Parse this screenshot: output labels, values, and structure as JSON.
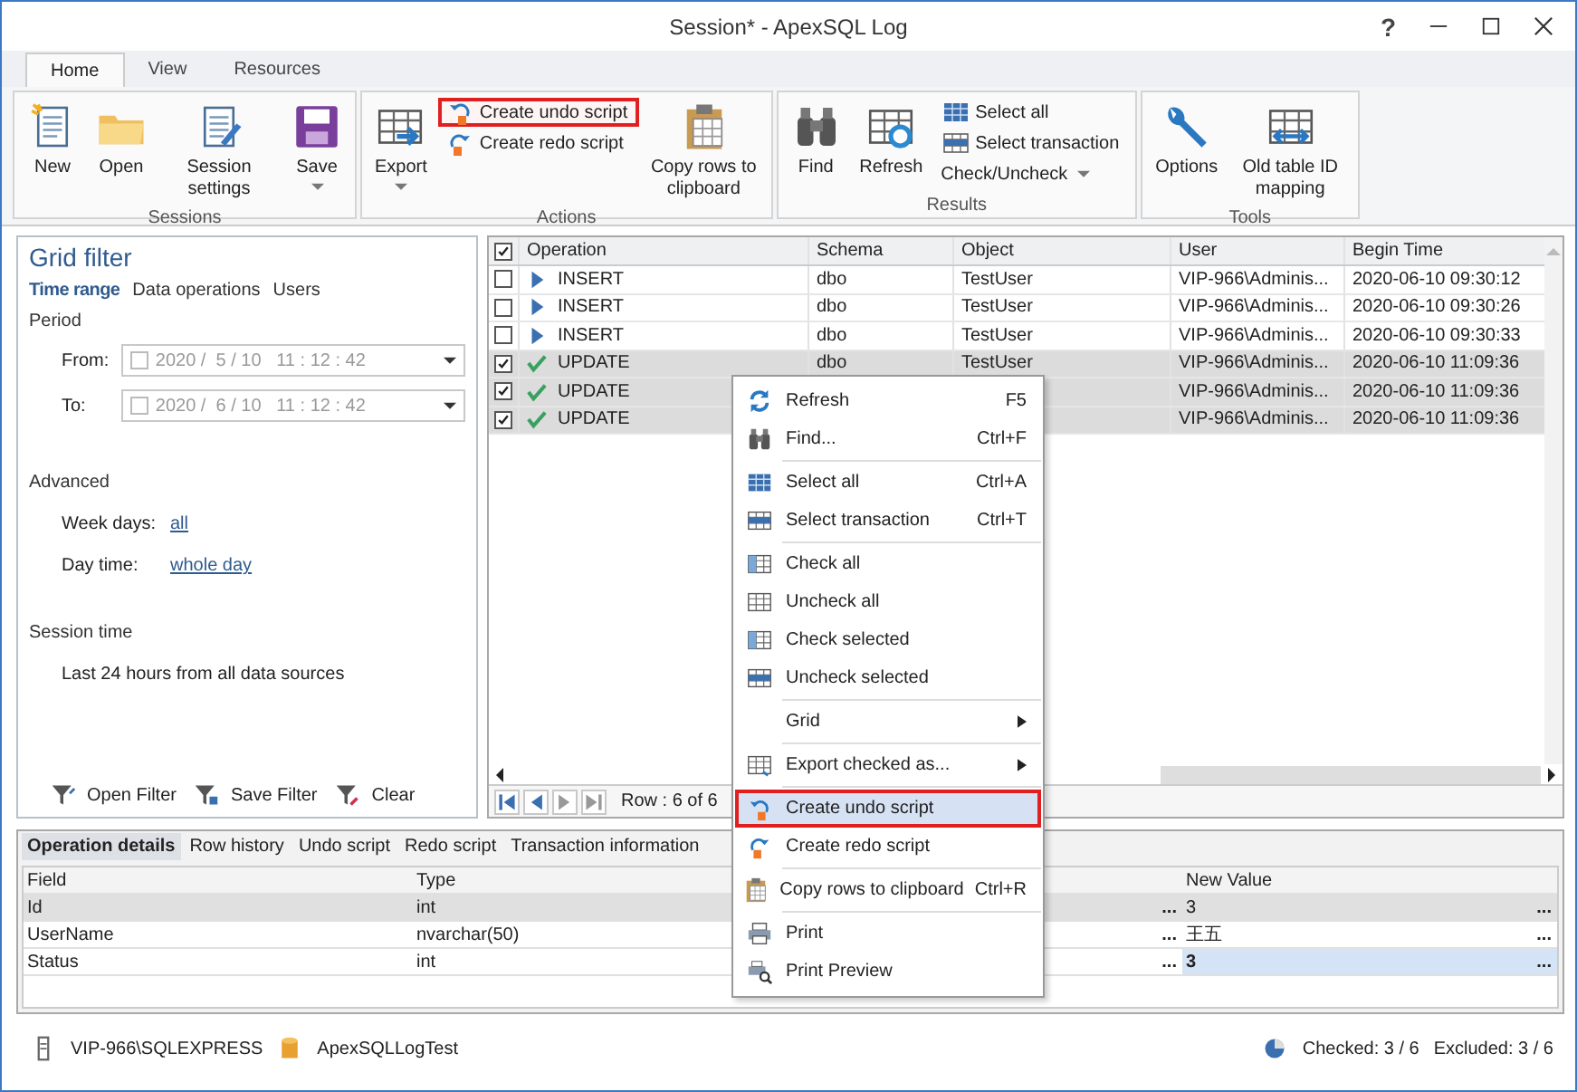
{
  "window": {
    "title": "Session* - ApexSQL Log",
    "help": "?"
  },
  "ribbon_tabs": [
    {
      "label": "Home",
      "selected": true
    },
    {
      "label": "View",
      "selected": false
    },
    {
      "label": "Resources",
      "selected": false
    }
  ],
  "ribbon_groups": [
    {
      "label": "Sessions",
      "items": [
        {
          "kind": "large",
          "label": "New",
          "dropdown": false,
          "highlighted": false
        },
        {
          "kind": "large",
          "label": "Open",
          "dropdown": false,
          "highlighted": false
        },
        {
          "kind": "large",
          "label": "Session settings",
          "dropdown": false,
          "highlighted": false
        },
        {
          "kind": "large",
          "label": "Save",
          "dropdown": true,
          "highlighted": false
        }
      ]
    },
    {
      "label": "Actions",
      "items": [
        {
          "kind": "large",
          "label": "Export",
          "dropdown": true,
          "highlighted": false
        },
        {
          "kind": "small",
          "label": "Create undo script",
          "dropdown": false,
          "highlighted": true
        },
        {
          "kind": "small",
          "label": "Create redo script",
          "dropdown": false,
          "highlighted": false
        },
        {
          "kind": "large",
          "label": "Copy rows to clipboard",
          "dropdown": false,
          "highlighted": false
        }
      ]
    },
    {
      "label": "Results",
      "items": [
        {
          "kind": "large",
          "label": "Find",
          "dropdown": false,
          "highlighted": false
        },
        {
          "kind": "large",
          "label": "Refresh",
          "dropdown": false,
          "highlighted": false
        },
        {
          "kind": "small",
          "label": "Select all",
          "dropdown": false,
          "highlighted": false
        },
        {
          "kind": "small",
          "label": "Select transaction",
          "dropdown": false,
          "highlighted": false
        },
        {
          "kind": "small",
          "label": "Check/Uncheck",
          "dropdown": true,
          "highlighted": false
        }
      ]
    },
    {
      "label": "Tools",
      "items": [
        {
          "kind": "large",
          "label": "Options",
          "dropdown": false,
          "highlighted": false
        },
        {
          "kind": "large",
          "label": "Old table ID mapping",
          "dropdown": false,
          "highlighted": false
        }
      ]
    }
  ],
  "grid_filter": {
    "title": "Grid filter",
    "tabs": [
      {
        "label": "Time range",
        "selected": true
      },
      {
        "label": "Data operations",
        "selected": false
      },
      {
        "label": "Users",
        "selected": false
      }
    ],
    "period": {
      "heading": "Period",
      "fields": [
        {
          "label": "From:",
          "value": "2020 /  5 / 10   11 : 12 : 42",
          "checked": false
        },
        {
          "label": "To:",
          "value": "2020 /  6 / 10   11 : 12 : 42",
          "checked": false
        }
      ]
    },
    "advanced": {
      "heading": "Advanced",
      "rows": [
        {
          "label": "Week days:",
          "link": "all"
        },
        {
          "label": "Day time:",
          "link": "whole day"
        }
      ]
    },
    "session_time": {
      "heading": "Session time",
      "text": "Last 24 hours from all data sources"
    },
    "buttons": [
      "Open Filter",
      "Save Filter",
      "Clear"
    ]
  },
  "grid": {
    "header_checked": true,
    "columns": [
      "Operation",
      "Schema",
      "Object",
      "User",
      "Begin Time"
    ],
    "rows": [
      {
        "checked": false,
        "selected": false,
        "kind": "insert",
        "operation": "INSERT",
        "schema": "dbo",
        "object": "TestUser",
        "user": "VIP-966\\Adminis...",
        "begin_time": "2020-06-10 09:30:12"
      },
      {
        "checked": false,
        "selected": false,
        "kind": "insert",
        "operation": "INSERT",
        "schema": "dbo",
        "object": "TestUser",
        "user": "VIP-966\\Adminis...",
        "begin_time": "2020-06-10 09:30:26"
      },
      {
        "checked": false,
        "selected": false,
        "kind": "insert",
        "operation": "INSERT",
        "schema": "dbo",
        "object": "TestUser",
        "user": "VIP-966\\Adminis...",
        "begin_time": "2020-06-10 09:30:33"
      },
      {
        "checked": true,
        "selected": true,
        "kind": "update",
        "operation": "UPDATE",
        "schema": "dbo",
        "object": "TestUser",
        "user": "VIP-966\\Adminis...",
        "begin_time": "2020-06-10 11:09:36"
      },
      {
        "checked": true,
        "selected": true,
        "kind": "update",
        "operation": "UPDATE",
        "user": "VIP-966\\Adminis...",
        "begin_time": "2020-06-10 11:09:36"
      },
      {
        "checked": true,
        "selected": true,
        "kind": "update",
        "operation": "UPDATE",
        "user": "VIP-966\\Adminis...",
        "begin_time": "2020-06-10 11:09:36"
      }
    ],
    "row_position": "Row : 6 of 6"
  },
  "context_menu": {
    "sections": [
      [
        {
          "label": "Refresh",
          "shortcut": "F5",
          "submenu": false,
          "highlighted": false
        },
        {
          "label": "Find...",
          "shortcut": "Ctrl+F",
          "submenu": false,
          "highlighted": false
        }
      ],
      [
        {
          "label": "Select all",
          "shortcut": "Ctrl+A",
          "submenu": false,
          "highlighted": false
        },
        {
          "label": "Select transaction",
          "shortcut": "Ctrl+T",
          "submenu": false,
          "highlighted": false
        }
      ],
      [
        {
          "label": "Check all",
          "submenu": false,
          "highlighted": false
        },
        {
          "label": "Uncheck all",
          "submenu": false,
          "highlighted": false
        },
        {
          "label": "Check selected",
          "submenu": false,
          "highlighted": false
        },
        {
          "label": "Uncheck selected",
          "submenu": false,
          "highlighted": false
        }
      ],
      [
        {
          "label": "Grid",
          "submenu": true,
          "highlighted": false
        }
      ],
      [
        {
          "label": "Export checked as...",
          "submenu": true,
          "highlighted": false
        }
      ],
      [
        {
          "label": "Create undo script",
          "submenu": false,
          "highlighted": true
        },
        {
          "label": "Create redo script",
          "submenu": false,
          "highlighted": false
        }
      ],
      [
        {
          "label": "Copy rows to clipboard",
          "shortcut": "Ctrl+R",
          "submenu": false,
          "highlighted": false
        }
      ],
      [
        {
          "label": "Print",
          "submenu": false,
          "highlighted": false
        },
        {
          "label": "Print Preview",
          "submenu": false,
          "highlighted": false
        }
      ]
    ]
  },
  "details": {
    "tabs": [
      {
        "label": "Operation details",
        "selected": true
      },
      {
        "label": "Row history",
        "selected": false
      },
      {
        "label": "Undo script",
        "selected": false
      },
      {
        "label": "Redo script",
        "selected": false
      },
      {
        "label": "Transaction information",
        "selected": false
      }
    ],
    "columns": [
      "Field",
      "Type",
      "New Value"
    ],
    "rows": [
      {
        "field": "Id",
        "type": "int",
        "column_3_button": "...",
        "new_value": "3",
        "new_value_button": "...",
        "selected": true,
        "focused": false
      },
      {
        "field": "UserName",
        "type": "nvarchar(50)",
        "column_3_button": "...",
        "new_value": "王五",
        "new_value_button": "...",
        "selected": false,
        "focused": false
      },
      {
        "field": "Status",
        "type": "int",
        "column_3_button": "...",
        "new_value": "3",
        "new_value_button": "...",
        "selected": false,
        "focused": true
      }
    ]
  },
  "status_bar": {
    "server": "VIP-966\\SQLEXPRESS",
    "database": "ApexSQLLogTest",
    "checked": "Checked: 3 / 6",
    "excluded": "Excluded: 3 / 6"
  }
}
